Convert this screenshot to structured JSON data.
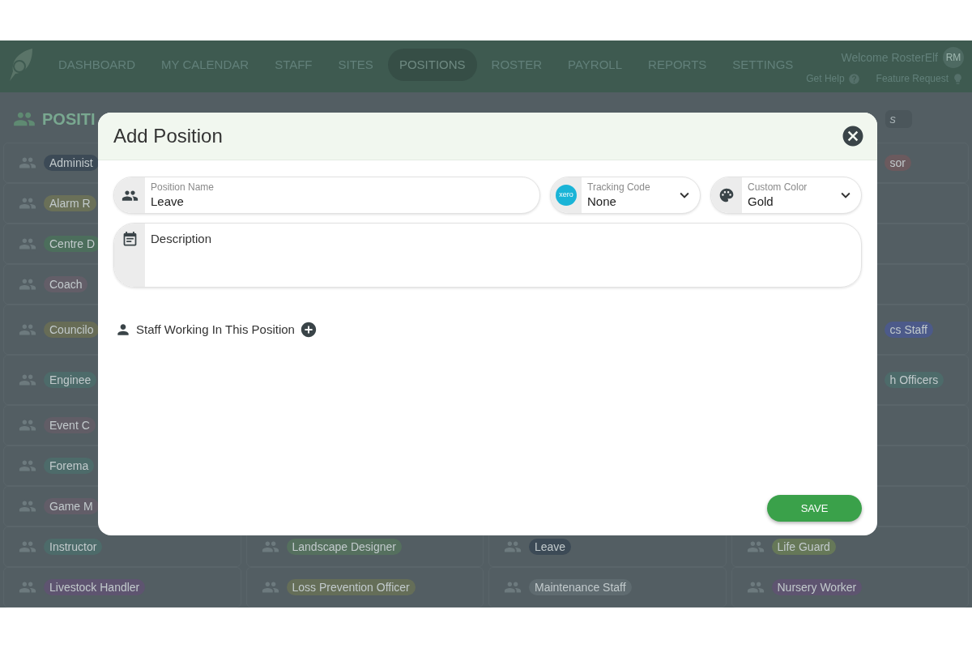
{
  "nav": {
    "items": [
      {
        "label": "DASHBOARD",
        "selected": false
      },
      {
        "label": "MY CALENDAR",
        "selected": false
      },
      {
        "label": "STAFF",
        "selected": false
      },
      {
        "label": "SITES",
        "selected": false
      },
      {
        "label": "POSITIONS",
        "selected": true
      },
      {
        "label": "ROSTER",
        "selected": false
      },
      {
        "label": "PAYROLL",
        "selected": false
      },
      {
        "label": "REPORTS",
        "selected": false
      },
      {
        "label": "SETTINGS",
        "selected": false
      }
    ],
    "welcome": "Welcome RosterElf",
    "avatar": "RM",
    "help": "Get Help",
    "feature": "Feature Request"
  },
  "page": {
    "title": "POSITI",
    "search_fragment": "s",
    "rows": [
      {
        "cells": [
          {
            "kind": "full",
            "label": "Administ",
            "color": "#3c4a56"
          },
          {
            "kind": "clipped",
            "label": "sor",
            "color": "#6b5a5e"
          }
        ]
      },
      {
        "cells": [
          {
            "kind": "full",
            "label": "Alarm R",
            "color": "#6a7058"
          }
        ]
      },
      {
        "cells": [
          {
            "kind": "full",
            "label": "Centre D",
            "color": "#4c6e5c"
          }
        ]
      },
      {
        "cells": [
          {
            "kind": "full",
            "label": "Coach",
            "color": "#635e68"
          }
        ]
      },
      {
        "cells": [
          {
            "kind": "full",
            "label": "Councilo",
            "color": "#676c56"
          },
          {
            "kind": "clipped",
            "label": "cs Staff",
            "color": "#4c5a8a"
          }
        ]
      },
      {
        "cells": [
          {
            "kind": "full",
            "label": "Enginee",
            "color": "#4d6b6a"
          },
          {
            "kind": "clipped",
            "label": "h Officers",
            "color": "#4d6b6a"
          }
        ]
      },
      {
        "cells": [
          {
            "kind": "full",
            "label": "Event C",
            "color": "#615d66"
          }
        ]
      },
      {
        "cells": [
          {
            "kind": "full",
            "label": "Forema",
            "color": "#4d6b6a"
          }
        ]
      },
      {
        "cells": [
          {
            "kind": "full",
            "label": "Game M",
            "color": "#625d68"
          }
        ]
      },
      {
        "cells": [
          {
            "kind": "full",
            "label": "Instructor",
            "color": "#4d6b6a"
          },
          {
            "kind": "full",
            "label": "Landscape Designer",
            "color": "#55705e"
          },
          {
            "kind": "full",
            "label": "Leave",
            "color": "#3c4a56"
          },
          {
            "kind": "full",
            "label": "Life Guard",
            "color": "#667858"
          }
        ]
      },
      {
        "cells": [
          {
            "kind": "full",
            "label": "Livestock Handler",
            "color": "#5e5470"
          },
          {
            "kind": "full",
            "label": "Loss Prevention Officer",
            "color": "#656e58"
          },
          {
            "kind": "full",
            "label": "Maintenance Staff",
            "color": "#5f6b70"
          },
          {
            "kind": "full",
            "label": "Nursery Worker",
            "color": "#5e5470"
          }
        ]
      }
    ]
  },
  "dialog": {
    "title": "Add Position",
    "position_name": {
      "label": "Position Name",
      "value": "Leave"
    },
    "tracking_code": {
      "label": "Tracking Code",
      "value": "None",
      "logo_text": "xero"
    },
    "custom_color": {
      "label": "Custom Color",
      "value": "Gold"
    },
    "description": {
      "placeholder": "Description"
    },
    "staff_label": "Staff Working In This Position",
    "save": "SAVE"
  }
}
